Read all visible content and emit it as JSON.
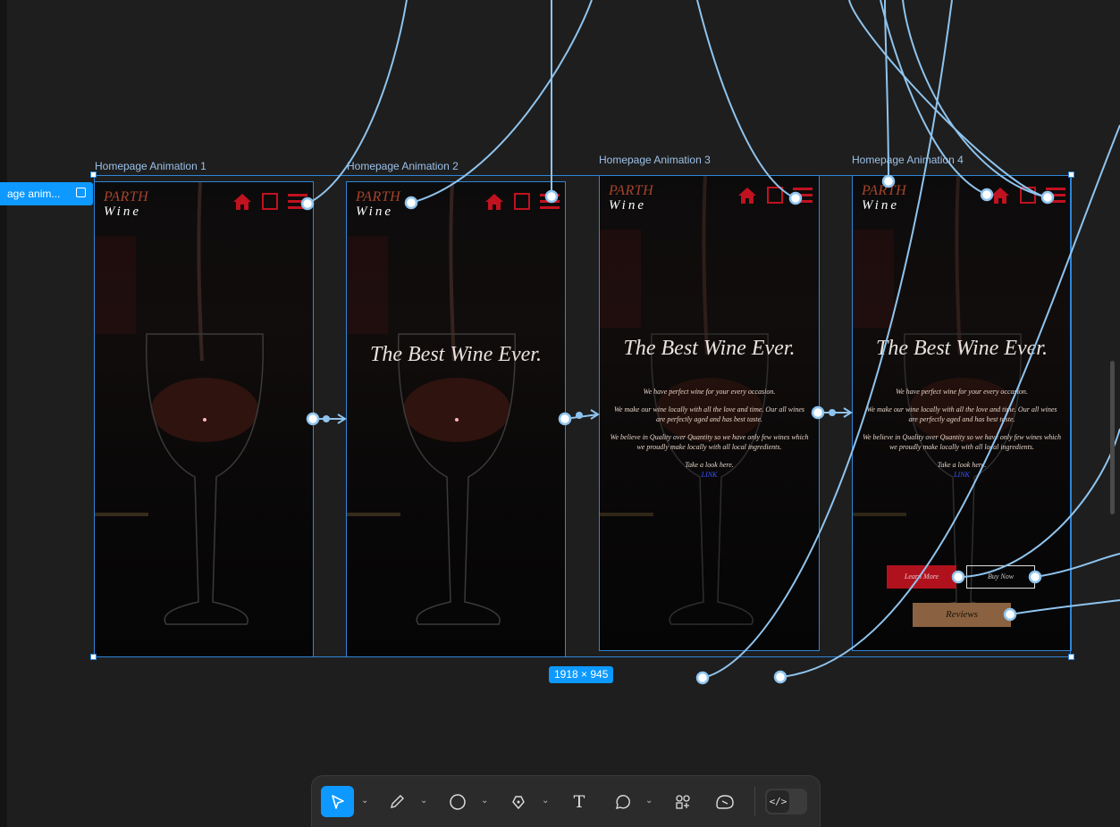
{
  "flow": {
    "chip_label": "age anim..."
  },
  "selection": {
    "size": "1918 × 945"
  },
  "frames": [
    {
      "label": "Homepage Animation 1"
    },
    {
      "label": "Homepage Animation 2"
    },
    {
      "label": "Homepage Animation 3"
    },
    {
      "label": "Homepage Animation 4"
    }
  ],
  "logo": {
    "top": "PARTH",
    "bottom": "Wine"
  },
  "hero": {
    "title": "The Best Wine Ever."
  },
  "description": {
    "p1": "We have perfect wine for your every occasion.",
    "p2": "We make our wine locally with all the love and time. Our all wines are perfectly aged and has best taste.",
    "p3": "We believe in Quality over Quantity so we have only few wines which we proudly make locally with all local ingredients.",
    "p4": "Take a look here.",
    "link": "LINK"
  },
  "buttons": {
    "learn": "Learn More",
    "buy": "Buy Now",
    "reviews": "Reviews"
  },
  "colors": {
    "selection": "#2f86d8",
    "accent": "#0d99ff",
    "brand_red": "#c0121f",
    "reviews": "#8a6241",
    "wire": "#8fc4ee"
  },
  "toolbar": {
    "tools": [
      "move-icon",
      "pencil-icon",
      "ellipse-icon",
      "pen-icon",
      "text-icon",
      "comment-icon",
      "components-icon",
      "actions-icon"
    ],
    "text_glyph": "T",
    "dev_mode_glyph": "</>"
  }
}
